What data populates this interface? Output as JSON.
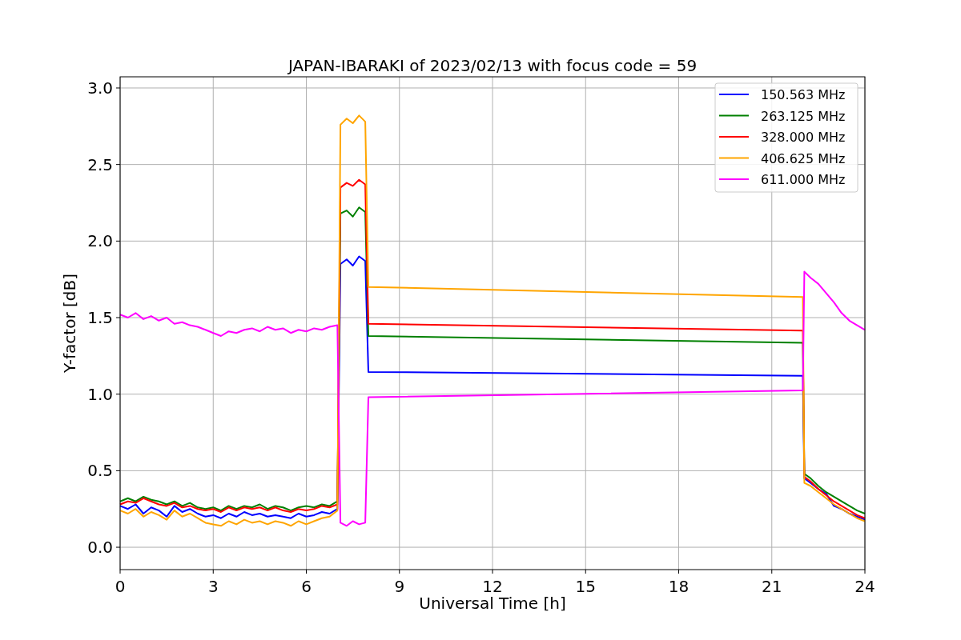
{
  "chart": {
    "chart_data": {
      "type": "line",
      "title": "JAPAN-IBARAKI of 2023/02/13 with focus code = 59",
      "xlabel": "Universal Time [h]",
      "ylabel": "Y-factor [dB]",
      "x": [
        0,
        0.25,
        0.5,
        0.75,
        1,
        1.25,
        1.5,
        1.75,
        2,
        2.25,
        2.5,
        2.75,
        3,
        3.25,
        3.5,
        3.75,
        4,
        4.25,
        4.5,
        4.75,
        5,
        5.25,
        5.5,
        5.75,
        6,
        6.25,
        6.5,
        6.75,
        7,
        7.1,
        7.3,
        7.5,
        7.7,
        7.9,
        8,
        22,
        22.05,
        22.25,
        22.5,
        22.75,
        23,
        23.25,
        23.5,
        23.75,
        24
      ],
      "series": [
        {
          "name": "150.563 MHz",
          "color": "#0000ff",
          "values": [
            0.27,
            0.25,
            0.28,
            0.22,
            0.26,
            0.24,
            0.2,
            0.27,
            0.23,
            0.25,
            0.22,
            0.2,
            0.21,
            0.19,
            0.22,
            0.2,
            0.23,
            0.21,
            0.22,
            0.2,
            0.21,
            0.2,
            0.19,
            0.22,
            0.2,
            0.21,
            0.23,
            0.22,
            0.25,
            1.85,
            1.88,
            1.84,
            1.9,
            1.87,
            1.145,
            1.12,
            0.45,
            0.42,
            0.38,
            0.35,
            0.27,
            0.25,
            0.22,
            0.2,
            0.18
          ]
        },
        {
          "name": "263.125 MHz",
          "color": "#008000",
          "values": [
            0.3,
            0.32,
            0.3,
            0.33,
            0.31,
            0.3,
            0.28,
            0.3,
            0.27,
            0.29,
            0.26,
            0.25,
            0.26,
            0.24,
            0.27,
            0.25,
            0.27,
            0.26,
            0.28,
            0.25,
            0.27,
            0.26,
            0.24,
            0.26,
            0.27,
            0.26,
            0.28,
            0.27,
            0.3,
            2.18,
            2.2,
            2.16,
            2.22,
            2.19,
            1.38,
            1.335,
            0.48,
            0.45,
            0.4,
            0.36,
            0.33,
            0.3,
            0.27,
            0.24,
            0.22
          ]
        },
        {
          "name": "328.000 MHz",
          "color": "#ff0000",
          "values": [
            0.28,
            0.3,
            0.29,
            0.32,
            0.3,
            0.28,
            0.27,
            0.29,
            0.26,
            0.27,
            0.25,
            0.24,
            0.25,
            0.23,
            0.26,
            0.24,
            0.26,
            0.25,
            0.26,
            0.24,
            0.26,
            0.24,
            0.23,
            0.25,
            0.24,
            0.25,
            0.27,
            0.26,
            0.28,
            2.35,
            2.38,
            2.36,
            2.4,
            2.37,
            1.46,
            1.415,
            0.46,
            0.43,
            0.38,
            0.34,
            0.3,
            0.27,
            0.24,
            0.21,
            0.19
          ]
        },
        {
          "name": "406.625 MHz",
          "color": "#ffa500",
          "values": [
            0.24,
            0.22,
            0.25,
            0.2,
            0.23,
            0.21,
            0.18,
            0.24,
            0.2,
            0.22,
            0.19,
            0.16,
            0.15,
            0.14,
            0.17,
            0.15,
            0.18,
            0.16,
            0.17,
            0.15,
            0.17,
            0.16,
            0.14,
            0.17,
            0.15,
            0.17,
            0.19,
            0.2,
            0.24,
            2.76,
            2.8,
            2.77,
            2.82,
            2.78,
            1.7,
            1.635,
            0.42,
            0.4,
            0.36,
            0.32,
            0.28,
            0.25,
            0.22,
            0.19,
            0.17
          ]
        },
        {
          "name": "611.000 MHz",
          "color": "#ff00ff",
          "values": [
            1.52,
            1.5,
            1.53,
            1.49,
            1.51,
            1.48,
            1.5,
            1.46,
            1.47,
            1.45,
            1.44,
            1.42,
            1.4,
            1.38,
            1.41,
            1.4,
            1.42,
            1.43,
            1.41,
            1.44,
            1.42,
            1.43,
            1.4,
            1.42,
            1.41,
            1.43,
            1.42,
            1.44,
            1.45,
            0.16,
            0.14,
            0.17,
            0.15,
            0.16,
            0.98,
            1.025,
            1.8,
            1.76,
            1.72,
            1.66,
            1.6,
            1.53,
            1.48,
            1.45,
            1.42
          ]
        }
      ],
      "grid": true,
      "legend": true,
      "xlim": [
        0,
        24
      ],
      "ylim": [
        -0.146,
        3.073
      ],
      "xticks": [
        0,
        3,
        6,
        9,
        12,
        15,
        18,
        21,
        24
      ],
      "yticks": [
        {
          "value": 0,
          "label": "0.0"
        },
        {
          "value": 0.5,
          "label": "0.5"
        },
        {
          "value": 1,
          "label": "1.0"
        },
        {
          "value": 1.5,
          "label": "1.5"
        },
        {
          "value": 2,
          "label": "2.0"
        },
        {
          "value": 2.5,
          "label": "2.5"
        },
        {
          "value": 3,
          "label": "3.0"
        }
      ]
    }
  }
}
